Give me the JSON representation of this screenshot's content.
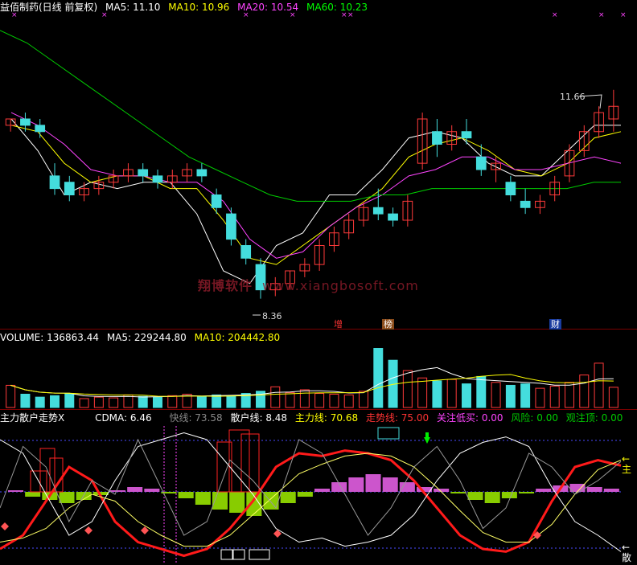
{
  "header": {
    "stock": "益佰制药(日线 前复权)",
    "ma5": "MA5: 11.10",
    "ma10": "MA10: 10.96",
    "ma20": "MA20: 10.54",
    "ma60": "MA60: 10.23"
  },
  "price_annotations": {
    "high": "11.66",
    "low": "8.36"
  },
  "event_marks": {
    "zeng": "增",
    "bang": "榜",
    "cai": "财"
  },
  "watermark": {
    "cn": "翔博软件",
    "url": "www.xiangbosoft.com"
  },
  "volume_header": {
    "volume": "VOLUME: 136863.44",
    "ma5": "MA5: 229244.80",
    "ma10": "MA10: 204442.80"
  },
  "indicator_header": {
    "name": "主力散户走势X",
    "cdma": "CDMA: 6.46",
    "kuaixian": "快线: 73.58",
    "sanhu": "散户线: 8.48",
    "zhuli": "主力线: 70.68",
    "zoushi": "走势线: 75.00",
    "guanzhu": "关注低买: 0.00",
    "fengxian": "风险: 0.00",
    "guanzhuding": "观注顶: 0.00"
  },
  "indicator_right_labels": {
    "a": "←主",
    "b": "←散"
  },
  "colors": {
    "up": "#ff3a3a",
    "down": "#44dddd",
    "ma5": "#ffffff",
    "ma10": "#ffff00",
    "ma20": "#ff44ff",
    "ma60": "#00cc00"
  },
  "chart_data": [
    {
      "type": "line",
      "title": "益佰制药(日线 前复权)",
      "x": [
        0,
        5,
        10,
        15,
        20,
        25,
        30,
        35,
        40,
        45,
        50,
        55,
        60,
        65,
        70,
        75,
        80,
        85,
        90,
        95,
        100,
        105,
        110,
        115,
        120,
        125,
        130,
        135,
        140,
        145,
        150,
        155
      ],
      "series": [
        {
          "name": "MA5",
          "values": [
            11.2,
            10.7,
            10.0,
            10.2,
            10.1,
            10.2,
            10.2,
            9.7,
            8.8,
            8.6,
            9.2,
            9.4,
            10.0,
            10.0,
            10.4,
            10.9,
            11.0,
            10.9,
            10.5,
            10.3,
            10.3,
            10.7,
            11.1,
            11.1
          ]
        },
        {
          "name": "MA10",
          "values": [
            11.1,
            11.0,
            10.5,
            10.2,
            10.3,
            10.3,
            10.1,
            10.1,
            9.6,
            9.0,
            8.9,
            9.2,
            9.5,
            9.8,
            10.1,
            10.6,
            10.8,
            10.9,
            10.7,
            10.4,
            10.3,
            10.5,
            10.9,
            11.0
          ]
        },
        {
          "name": "MA20",
          "values": [
            11.3,
            11.1,
            10.8,
            10.4,
            10.3,
            10.3,
            10.2,
            10.2,
            9.9,
            9.3,
            9.0,
            9.1,
            9.5,
            9.8,
            10.0,
            10.3,
            10.4,
            10.6,
            10.6,
            10.4,
            10.4,
            10.5,
            10.6,
            10.5
          ]
        },
        {
          "name": "MA60",
          "values": [
            12.6,
            12.4,
            12.1,
            11.8,
            11.5,
            11.2,
            10.9,
            10.6,
            10.4,
            10.2,
            10.0,
            9.9,
            9.9,
            9.9,
            10.0,
            10.0,
            10.1,
            10.1,
            10.1,
            10.1,
            10.1,
            10.1,
            10.2,
            10.2
          ]
        }
      ],
      "candles": [
        [
          11.1,
          11.2,
          11.0,
          11.2
        ],
        [
          11.2,
          11.3,
          11.0,
          11.1
        ],
        [
          11.1,
          11.2,
          10.9,
          11.0
        ],
        [
          10.3,
          10.5,
          10.0,
          10.1
        ],
        [
          10.2,
          10.3,
          9.9,
          10.0
        ],
        [
          10.0,
          10.2,
          9.9,
          10.1
        ],
        [
          10.1,
          10.3,
          10.0,
          10.2
        ],
        [
          10.2,
          10.4,
          10.1,
          10.3
        ],
        [
          10.3,
          10.5,
          10.2,
          10.4
        ],
        [
          10.4,
          10.5,
          10.2,
          10.3
        ],
        [
          10.3,
          10.4,
          10.1,
          10.2
        ],
        [
          10.2,
          10.4,
          10.1,
          10.3
        ],
        [
          10.3,
          10.5,
          10.2,
          10.4
        ],
        [
          10.4,
          10.5,
          10.2,
          10.3
        ],
        [
          10.0,
          10.1,
          9.7,
          9.8
        ],
        [
          9.7,
          9.8,
          9.2,
          9.3
        ],
        [
          9.2,
          9.3,
          8.9,
          9.0
        ],
        [
          8.9,
          9.0,
          8.36,
          8.5
        ],
        [
          8.5,
          8.7,
          8.4,
          8.6
        ],
        [
          8.6,
          8.8,
          8.5,
          8.8
        ],
        [
          8.8,
          9.0,
          8.7,
          8.9
        ],
        [
          8.9,
          9.3,
          8.8,
          9.2
        ],
        [
          9.2,
          9.5,
          9.1,
          9.4
        ],
        [
          9.4,
          9.7,
          9.3,
          9.6
        ],
        [
          9.6,
          9.9,
          9.5,
          9.8
        ],
        [
          9.8,
          10.1,
          9.6,
          9.7
        ],
        [
          9.7,
          9.8,
          9.5,
          9.6
        ],
        [
          9.6,
          10.0,
          9.5,
          9.9
        ],
        [
          10.5,
          11.3,
          10.4,
          11.2
        ],
        [
          11.0,
          11.2,
          10.6,
          10.8
        ],
        [
          10.8,
          11.1,
          10.7,
          11.0
        ],
        [
          11.0,
          11.2,
          10.8,
          10.9
        ],
        [
          10.6,
          10.8,
          10.3,
          10.4
        ],
        [
          10.4,
          10.6,
          10.2,
          10.5
        ],
        [
          10.2,
          10.3,
          9.9,
          10.0
        ],
        [
          9.9,
          10.1,
          9.7,
          9.8
        ],
        [
          9.8,
          10.0,
          9.7,
          9.9
        ],
        [
          10.0,
          10.3,
          9.9,
          10.2
        ],
        [
          10.3,
          10.8,
          10.2,
          10.7
        ],
        [
          10.7,
          11.1,
          10.6,
          11.0
        ],
        [
          11.0,
          11.4,
          10.9,
          11.3
        ],
        [
          11.2,
          11.66,
          11.0,
          11.4
        ]
      ],
      "annotations": [
        "11.66",
        "8.36"
      ]
    },
    {
      "type": "bar",
      "title": "VOLUME: 136863.44",
      "series": [
        {
          "name": "VOLUME",
          "values": [
            150000,
            90000,
            70000,
            80000,
            95000,
            60000,
            70000,
            65000,
            85000,
            75000,
            70000,
            80000,
            90000,
            75000,
            85000,
            80000,
            95000,
            110000,
            140000,
            100000,
            120000,
            95000,
            90000,
            85000,
            110000,
            400000,
            320000,
            250000,
            200000,
            180000,
            190000,
            160000,
            210000,
            170000,
            150000,
            160000,
            130000,
            145000,
            170000,
            220000,
            300000,
            136863
          ]
        }
      ]
    },
    {
      "type": "line",
      "title": "主力散户走势X",
      "series": [
        {
          "name": "主力线",
          "values": [
            10,
            20,
            45,
            70,
            60,
            30,
            15,
            10,
            5,
            10,
            25,
            45,
            70,
            80,
            78,
            82,
            80,
            75,
            60,
            40,
            20,
            10,
            8,
            15,
            45,
            70,
            75,
            71
          ]
        },
        {
          "name": "散户线",
          "values": [
            90,
            80,
            50,
            20,
            30,
            60,
            85,
            90,
            95,
            90,
            70,
            50,
            25,
            15,
            18,
            12,
            15,
            20,
            35,
            60,
            80,
            88,
            92,
            85,
            55,
            30,
            20,
            8
          ]
        },
        {
          "name": "走势线",
          "values": [
            15,
            18,
            25,
            40,
            50,
            45,
            30,
            20,
            12,
            12,
            20,
            35,
            50,
            65,
            72,
            78,
            80,
            78,
            70,
            55,
            38,
            22,
            15,
            15,
            28,
            50,
            68,
            75
          ]
        },
        {
          "name": "快线",
          "values": [
            40,
            85,
            70,
            30,
            60,
            50,
            90,
            55,
            20,
            30,
            75,
            60,
            40,
            90,
            80,
            50,
            20,
            40,
            70,
            85,
            60,
            25,
            40,
            80,
            70,
            50,
            60,
            74
          ]
        }
      ]
    }
  ]
}
